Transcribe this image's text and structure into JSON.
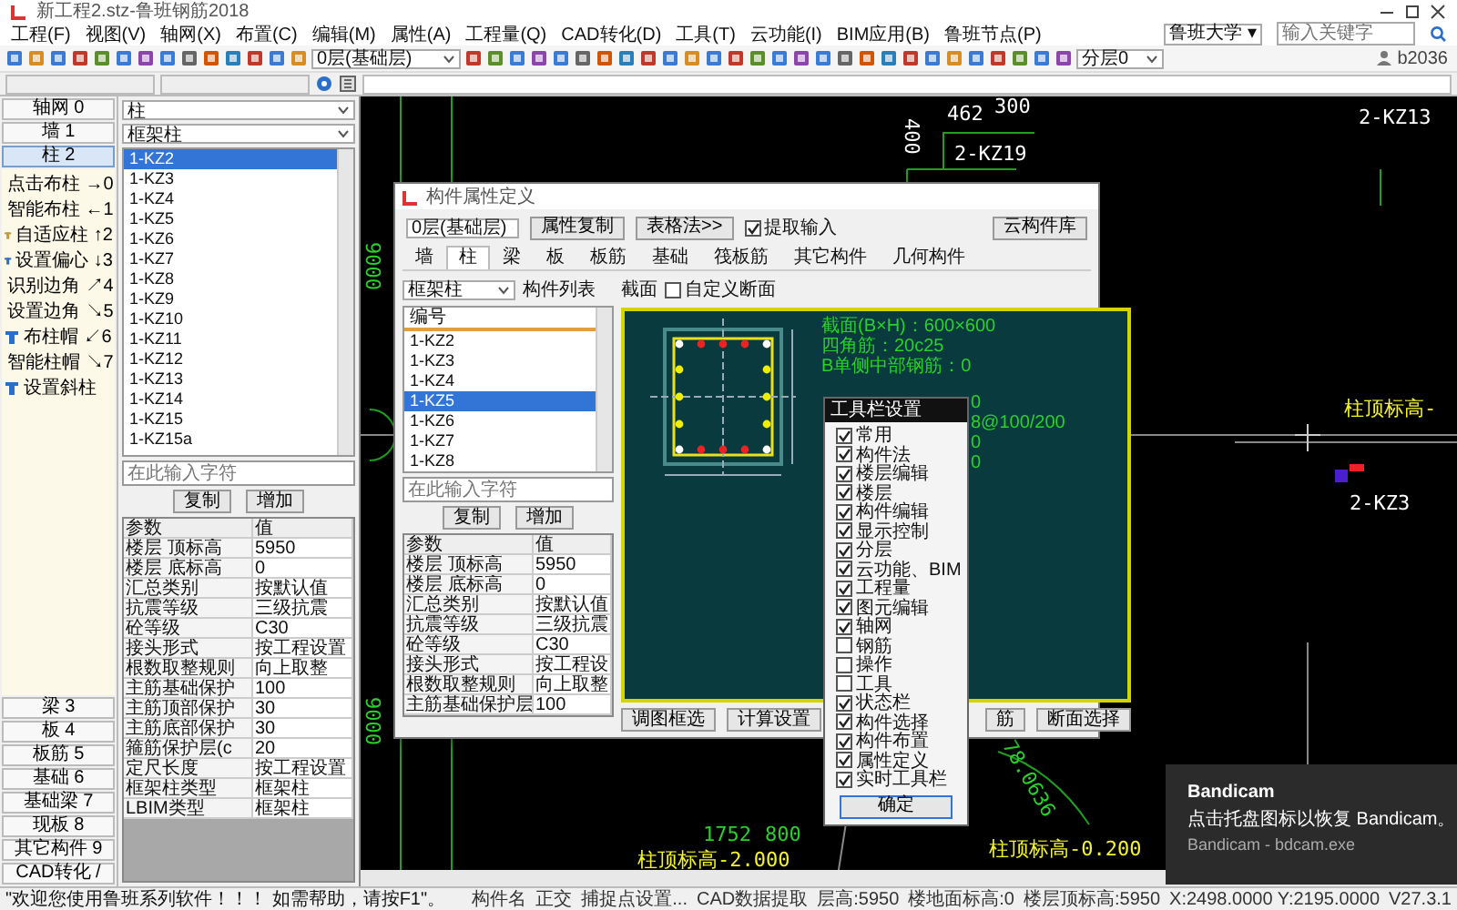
{
  "window": {
    "title": "新工程2.stz-鲁班钢筋2018"
  },
  "menu": [
    "工程(F)",
    "视图(V)",
    "轴网(X)",
    "布置(C)",
    "编辑(M)",
    "属性(A)",
    "工程量(Q)",
    "CAD转化(D)",
    "工具(T)",
    "云功能(I)",
    "BIM应用(B)",
    "鲁班节点(P)"
  ],
  "help_search": {
    "scope": "鲁班大学 ▾",
    "placeholder": "输入关键字"
  },
  "toolbar": {
    "floor": "0层(基础层)",
    "layer": "分层0",
    "user": "b2036"
  },
  "left_panel": {
    "categories": [
      {
        "label": "轴网 0",
        "selected": false
      },
      {
        "label": "墙 1",
        "selected": false
      },
      {
        "label": "柱 2",
        "selected": true
      }
    ],
    "tools": [
      "点击布柱 →0",
      "智能布柱 ←1",
      "自适应柱 ↑2",
      "设置偏心 ↓3",
      "识别边角 ↗4",
      "设置边角 ↘5",
      "布柱帽 ↙6",
      "智能柱帽 ↘7",
      "设置斜柱"
    ],
    "more_categories": [
      {
        "label": "梁 3",
        "selected": false
      },
      {
        "label": "板 4",
        "selected": false
      },
      {
        "label": "板筋 5",
        "selected": false
      },
      {
        "label": "基础 6",
        "selected": false
      },
      {
        "label": "基础梁 7",
        "selected": false
      },
      {
        "label": "现板 8",
        "selected": false
      },
      {
        "label": "其它构件 9",
        "selected": false
      },
      {
        "label": "CAD转化 /",
        "selected": false
      }
    ]
  },
  "component_panel": {
    "type_select": "柱",
    "subtype_select": "框架柱",
    "items": [
      {
        "label": "1-KZ2",
        "selected": true
      },
      {
        "label": "1-KZ3",
        "selected": false
      },
      {
        "label": "1-KZ4",
        "selected": false
      },
      {
        "label": "1-KZ5",
        "selected": false
      },
      {
        "label": "1-KZ6",
        "selected": false
      },
      {
        "label": "1-KZ7",
        "selected": false
      },
      {
        "label": "1-KZ8",
        "selected": false
      },
      {
        "label": "1-KZ9",
        "selected": false
      },
      {
        "label": "1-KZ10",
        "selected": false
      },
      {
        "label": "1-KZ11",
        "selected": false
      },
      {
        "label": "1-KZ12",
        "selected": false
      },
      {
        "label": "1-KZ13",
        "selected": false
      },
      {
        "label": "1-KZ14",
        "selected": false
      },
      {
        "label": "1-KZ15",
        "selected": false
      },
      {
        "label": "1-KZ15a",
        "selected": false
      }
    ],
    "search_placeholder": "在此输入字符",
    "buttons": [
      "复制",
      "增加"
    ],
    "properties": {
      "columns": [
        "参数",
        "值"
      ],
      "rows": [
        [
          "楼层 顶标高",
          "5950"
        ],
        [
          "楼层 底标高",
          "0"
        ],
        [
          "汇总类别",
          "按默认值"
        ],
        [
          "抗震等级",
          "三级抗震"
        ],
        [
          "砼等级",
          "C30"
        ],
        [
          "接头形式",
          "按工程设置"
        ],
        [
          "根数取整规则",
          "向上取整"
        ],
        [
          "主筋基础保护",
          "100"
        ],
        [
          "主筋顶部保护",
          "30"
        ],
        [
          "主筋底部保护",
          "30"
        ],
        [
          "箍筋保护层(c",
          "20"
        ],
        [
          "定尺长度",
          "按工程设置"
        ],
        [
          "框架柱类型",
          "框架柱"
        ],
        [
          "LBIM类型",
          "框架柱"
        ]
      ]
    }
  },
  "dialog": {
    "title": "构件属性定义",
    "floor": "0层(基础层)",
    "buttons": [
      "属性复制",
      "表格法>>"
    ],
    "extract_input": {
      "label": "提取输入",
      "checked": true
    },
    "cloud_button": "云构件库",
    "tabs": [
      {
        "label": "墙",
        "selected": false
      },
      {
        "label": "柱",
        "selected": true
      },
      {
        "label": "梁",
        "selected": false
      },
      {
        "label": "板",
        "selected": false
      },
      {
        "label": "板筋",
        "selected": false
      },
      {
        "label": "基础",
        "selected": false
      },
      {
        "label": "筏板筋",
        "selected": false
      },
      {
        "label": "其它构件",
        "selected": false
      },
      {
        "label": "几何构件",
        "selected": false
      }
    ],
    "type_select": "框架柱",
    "list_label": "构件列表",
    "list_header": "编号",
    "items": [
      {
        "label": "1-KZ2",
        "selected": false
      },
      {
        "label": "1-KZ3",
        "selected": false
      },
      {
        "label": "1-KZ4",
        "selected": false
      },
      {
        "label": "1-KZ5",
        "selected": true
      },
      {
        "label": "1-KZ6",
        "selected": false
      },
      {
        "label": "1-KZ7",
        "selected": false
      },
      {
        "label": "1-KZ8",
        "selected": false
      }
    ],
    "search_placeholder": "在此输入字符",
    "list_buttons": [
      "复制",
      "增加"
    ],
    "properties": {
      "columns": [
        "参数",
        "值"
      ],
      "rows": [
        [
          "楼层 顶标高",
          "5950"
        ],
        [
          "楼层 底标高",
          "0"
        ],
        [
          "汇总类别",
          "按默认值"
        ],
        [
          "抗震等级",
          "三级抗震"
        ],
        [
          "砼等级",
          "C30"
        ],
        [
          "接头形式",
          "按工程设"
        ],
        [
          "根数取整规则",
          "向上取整"
        ],
        [
          "主筋基础保护层",
          "100"
        ]
      ]
    },
    "section_label": "截面",
    "custom_section": {
      "label": "自定义断面",
      "checked": false
    },
    "section_specs": [
      "截面(B×H)：600×600",
      "四角筋：20c25",
      "B单侧中部钢筋：0"
    ],
    "section_specs_partial": [
      "0",
      "8@100/200",
      "0",
      "0"
    ],
    "bottom_buttons": [
      "调图框选",
      "计算设置",
      "筋",
      "断面选择"
    ]
  },
  "toolbar_settings": {
    "title": "工具栏设置",
    "items": [
      {
        "label": "常用",
        "checked": true
      },
      {
        "label": "构件法",
        "checked": true
      },
      {
        "label": "楼层编辑",
        "checked": true
      },
      {
        "label": "楼层",
        "checked": true
      },
      {
        "label": "构件编辑",
        "checked": true
      },
      {
        "label": "显示控制",
        "checked": true
      },
      {
        "label": "分层",
        "checked": true
      },
      {
        "label": "云功能、BIM",
        "checked": true
      },
      {
        "label": "工程量",
        "checked": true
      },
      {
        "label": "图元编辑",
        "checked": true
      },
      {
        "label": "轴网",
        "checked": true
      },
      {
        "label": "钢筋",
        "checked": false
      },
      {
        "label": "操作",
        "checked": false
      },
      {
        "label": "工具",
        "checked": false
      },
      {
        "label": "状态栏",
        "checked": true
      },
      {
        "label": "构件选择",
        "checked": true
      },
      {
        "label": "构件布置",
        "checked": true
      },
      {
        "label": "属性定义",
        "checked": true
      },
      {
        "label": "实时工具栏",
        "checked": true
      }
    ],
    "ok": "确定"
  },
  "canvas": {
    "labels": [
      "9000",
      "9000",
      "462",
      "300",
      "400",
      "2-KZ19",
      "2-KZ13",
      "柱顶标高-",
      "2-KZ3",
      "1752",
      "800",
      "柱顶标高-2.000",
      "柱顶标高-0.200",
      "78.0636"
    ]
  },
  "status_bar": {
    "message": "\"欢迎您使用鲁班系列软件！！！ 如需帮助，请按F1\"。",
    "items": [
      "构件名",
      "正交",
      "捕捉点设置...",
      "CAD数据提取",
      "层高:5950",
      "楼地面标高:0",
      "楼层顶标高:5950",
      "X:2498.0000 Y:2195.0000",
      "V27.3.1"
    ]
  },
  "notification": {
    "app": "Bandicam",
    "message": "点击托盘图标以恢复 Bandicam。",
    "source": "Bandicam - bdcam.exe"
  }
}
